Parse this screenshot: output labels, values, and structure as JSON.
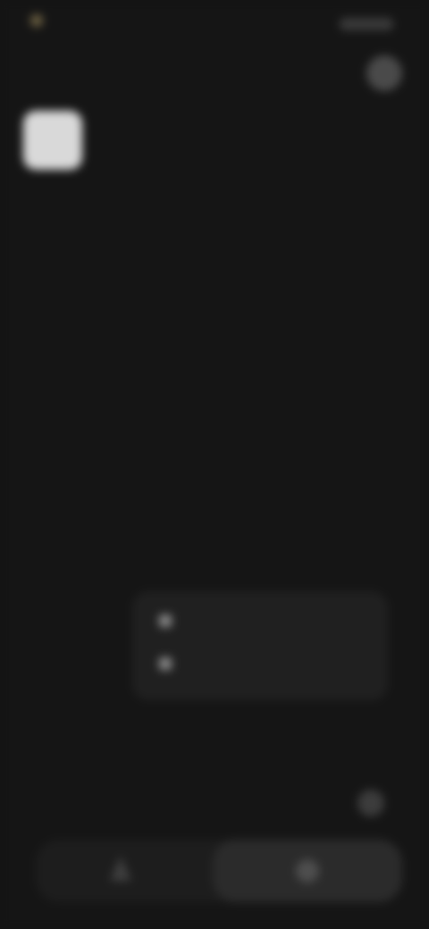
{
  "status_bar": {
    "time": "",
    "accent_color": "#b8a26a"
  },
  "main": {
    "title": "",
    "subtitle": ""
  },
  "options": [
    {
      "label": "",
      "icon": "option-icon"
    },
    {
      "label": "",
      "icon": "option-icon"
    }
  ],
  "composer": {
    "placeholder": ""
  },
  "icons": {
    "menu": "menu-icon",
    "app": "app-logo-icon",
    "mic": "mic-icon",
    "bottom_left": "triangle-icon",
    "bottom_right": "circle-icon"
  }
}
